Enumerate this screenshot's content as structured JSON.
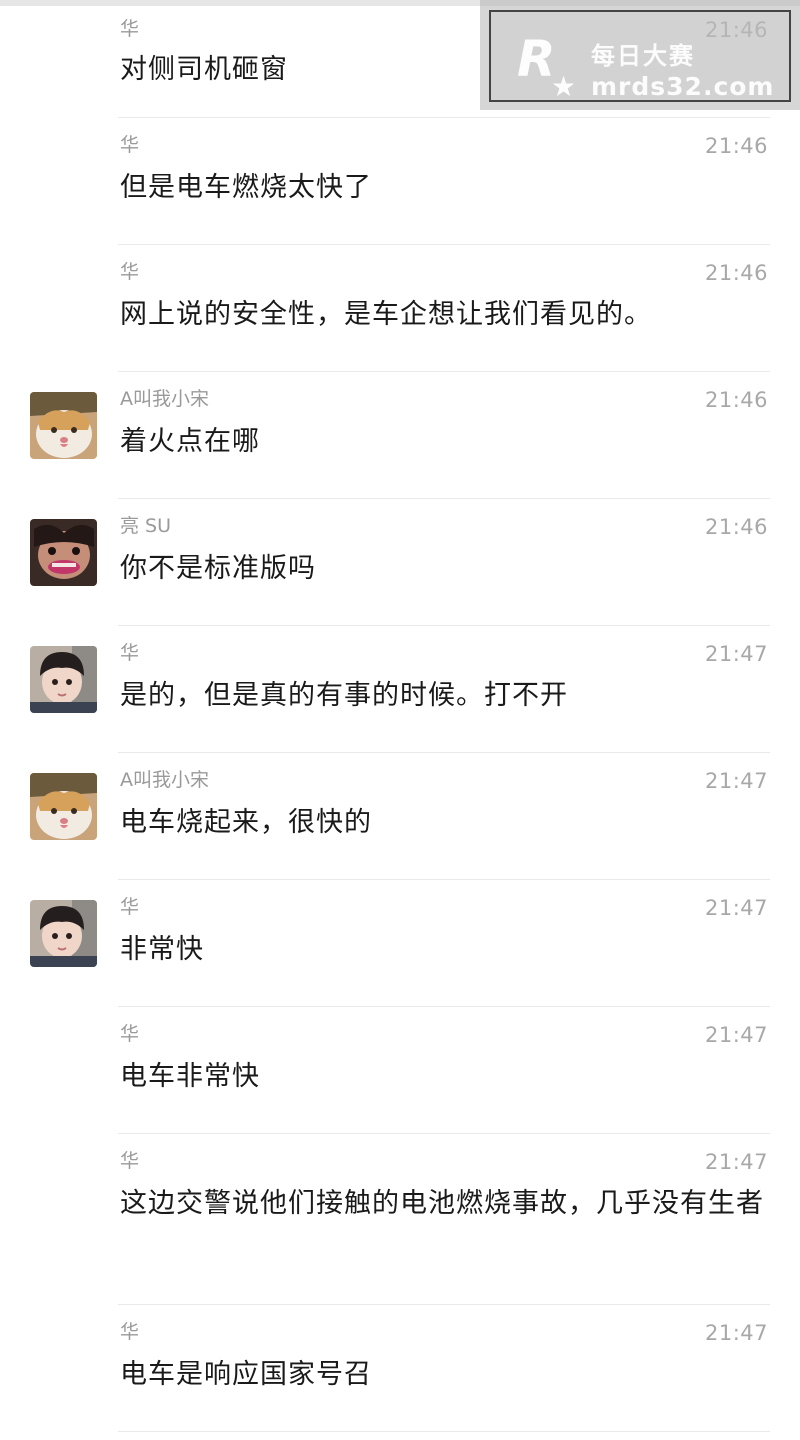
{
  "messages": [
    {
      "sender": "华",
      "time": "21:46",
      "text": "对侧司机砸窗",
      "avatar": null
    },
    {
      "sender": "华",
      "time": "21:46",
      "text": "但是电车燃烧太快了",
      "avatar": null
    },
    {
      "sender": "华",
      "time": "21:46",
      "text": "网上说的安全性，是车企想让我们看见的。",
      "avatar": null
    },
    {
      "sender": "A叫我小宋",
      "time": "21:46",
      "text": "着火点在哪",
      "avatar": "cat"
    },
    {
      "sender": "亮 SU",
      "time": "21:46",
      "text": "你不是标准版吗",
      "avatar": "face"
    },
    {
      "sender": "华",
      "time": "21:47",
      "text": "是的，但是真的有事的时候。打不开",
      "avatar": "boy"
    },
    {
      "sender": "A叫我小宋",
      "time": "21:47",
      "text": "电车烧起来，很快的",
      "avatar": "cat"
    },
    {
      "sender": "华",
      "time": "21:47",
      "text": "非常快",
      "avatar": "boy"
    },
    {
      "sender": "华",
      "time": "21:47",
      "text": "电车非常快",
      "avatar": null
    },
    {
      "sender": "华",
      "time": "21:47",
      "text": "这边交警说他们接触的电池燃烧事故，几乎没有生者",
      "avatar": null
    },
    {
      "sender": "华",
      "time": "21:47",
      "text": "电车是响应国家号召",
      "avatar": null
    }
  ],
  "watermark": {
    "logo_letter": "R",
    "title": "每日大赛",
    "url": "mrds32.com"
  }
}
